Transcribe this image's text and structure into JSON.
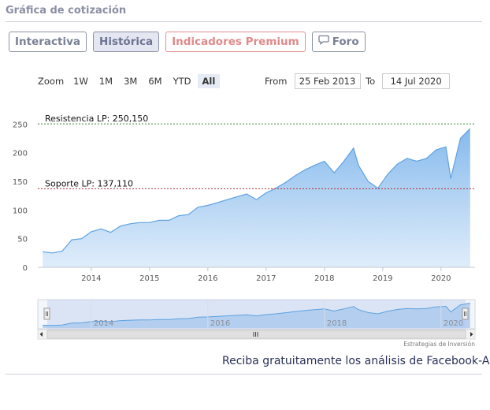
{
  "header": {
    "title": "Gráfica de cotización"
  },
  "tabs": [
    {
      "label": "Interactiva"
    },
    {
      "label": "Histórica"
    },
    {
      "label": "Indicadores Premium"
    },
    {
      "label": "Foro"
    }
  ],
  "zoom": {
    "label": "Zoom",
    "buttons": [
      "1W",
      "1M",
      "3M",
      "6M",
      "YTD",
      "All"
    ],
    "selected": "All"
  },
  "range": {
    "from_label": "From",
    "from_value": "25 Feb 2013",
    "to_label": "To",
    "to_value": "14 Jul 2020"
  },
  "colors": {
    "line": "#5ea2e0",
    "resistance": "#3a8a3a",
    "support": "#b03030"
  },
  "chart_data": {
    "type": "area",
    "xlabel": "",
    "ylabel": "",
    "ylim": [
      0,
      260
    ],
    "yticks": [
      0,
      50,
      100,
      150,
      200,
      250
    ],
    "xticks": [
      "2014",
      "2015",
      "2016",
      "2017",
      "2018",
      "2019",
      "2020"
    ],
    "grid": "off",
    "annotations": [
      {
        "label": "Resistencia LP: 250,150",
        "value": 250.15
      },
      {
        "label": "Soporte LP: 137,110",
        "value": 137.11
      }
    ],
    "series": [
      {
        "x": [
          "2013-03",
          "2013-05",
          "2013-07",
          "2013-08",
          "2013-09",
          "2013-11",
          "2014-01",
          "2014-03",
          "2014-05",
          "2014-07",
          "2014-09",
          "2014-11",
          "2015-01",
          "2015-03",
          "2015-05",
          "2015-07",
          "2015-09",
          "2015-11",
          "2016-01",
          "2016-03",
          "2016-05",
          "2016-07",
          "2016-09",
          "2016-11",
          "2017-01",
          "2017-03",
          "2017-05",
          "2017-07",
          "2017-09",
          "2017-11",
          "2018-01",
          "2018-03",
          "2018-05",
          "2018-07",
          "2018-08",
          "2018-10",
          "2018-12",
          "2019-02",
          "2019-04",
          "2019-06",
          "2019-08",
          "2019-10",
          "2019-12",
          "2020-02",
          "2020-03",
          "2020-05",
          "2020-07"
        ],
        "values": [
          27,
          25,
          28,
          38,
          48,
          50,
          62,
          67,
          61,
          72,
          76,
          78,
          78,
          82,
          82,
          90,
          92,
          105,
          108,
          113,
          118,
          123,
          128,
          118,
          130,
          138,
          148,
          160,
          170,
          178,
          185,
          165,
          185,
          208,
          178,
          150,
          138,
          162,
          180,
          190,
          185,
          190,
          205,
          210,
          155,
          225,
          242
        ]
      }
    ]
  },
  "navigator": {
    "xticks": [
      "2014",
      "2016",
      "2018",
      "2020"
    ]
  },
  "credit": "Estrategias de Inversión",
  "footer": {
    "text": "Reciba gratuitamente los análisis de Facebook-A"
  }
}
